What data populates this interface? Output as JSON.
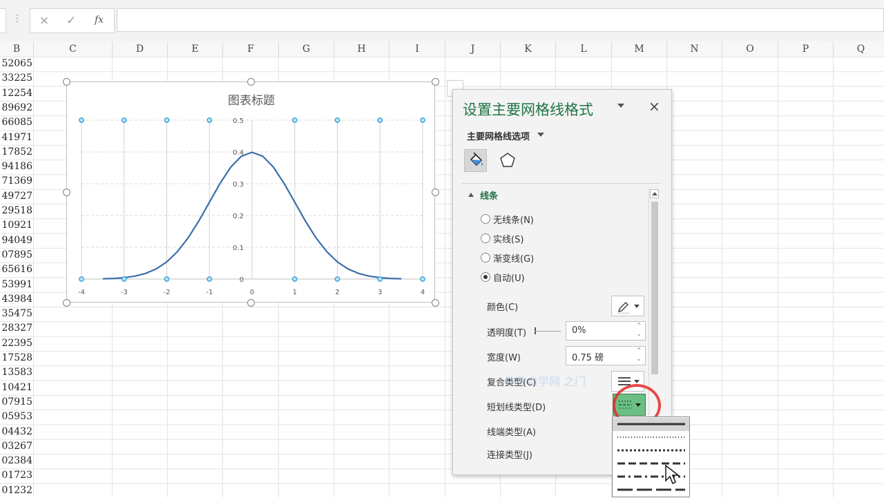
{
  "formula_bar": {
    "cancel_icon": "×",
    "enter_icon": "✓",
    "fx_label": "fx"
  },
  "columns": [
    "B",
    "C",
    "D",
    "E",
    "F",
    "G",
    "H",
    "I",
    "J",
    "K",
    "L",
    "M",
    "N",
    "O",
    "P",
    "Q"
  ],
  "column_b_values": [
    "52065",
    "33225",
    "12254",
    "89692",
    "66085",
    "41971",
    "17852",
    "94186",
    "71369",
    "49727",
    "29518",
    "10921",
    "94049",
    "07895",
    "65616",
    "53991",
    "43984",
    "35475",
    "28327",
    "22395",
    "17528",
    "13583",
    "10421",
    "07915",
    "05953",
    "04432",
    "03267",
    "02384",
    "01723",
    "01232"
  ],
  "chart": {
    "title": "图表标题"
  },
  "chart_data": {
    "type": "line",
    "title": "图表标题",
    "xlabel": "",
    "ylabel": "",
    "xlim": [
      -4,
      4
    ],
    "ylim": [
      0,
      0.5
    ],
    "x_ticks": [
      "-4",
      "-3",
      "-2",
      "-1",
      "0",
      "1",
      "2",
      "3",
      "4"
    ],
    "y_ticks": [
      "0",
      "0.1",
      "0.2",
      "0.3",
      "0.4",
      "0.5"
    ],
    "series": [
      {
        "values": [
          [
            -3.5,
            0.0009
          ],
          [
            -3.25,
            0.002
          ],
          [
            -3,
            0.0044
          ],
          [
            -2.75,
            0.0091
          ],
          [
            -2.5,
            0.0175
          ],
          [
            -2.25,
            0.0317
          ],
          [
            -2,
            0.054
          ],
          [
            -1.75,
            0.0863
          ],
          [
            -1.5,
            0.1295
          ],
          [
            -1.25,
            0.1826
          ],
          [
            -1,
            0.242
          ],
          [
            -0.75,
            0.3011
          ],
          [
            -0.5,
            0.3521
          ],
          [
            -0.25,
            0.3867
          ],
          [
            0,
            0.3989
          ],
          [
            0.25,
            0.3867
          ],
          [
            0.5,
            0.3521
          ],
          [
            0.75,
            0.3011
          ],
          [
            1,
            0.242
          ],
          [
            1.25,
            0.1826
          ],
          [
            1.5,
            0.1295
          ],
          [
            1.75,
            0.0863
          ],
          [
            2,
            0.054
          ],
          [
            2.25,
            0.0317
          ],
          [
            2.5,
            0.0175
          ],
          [
            2.75,
            0.0091
          ],
          [
            3,
            0.0044
          ],
          [
            3.25,
            0.002
          ],
          [
            3.5,
            0.0009
          ]
        ]
      }
    ],
    "grid": "dashed horizontal, selected vertical gridlines",
    "line_color": "#3b6ea8",
    "marker_color": "#2e9fd8"
  },
  "pane": {
    "title": "设置主要网格线格式",
    "close_icon": "×",
    "subtitle": "主要网格线选项",
    "section_title": "线条",
    "radio_options": [
      {
        "label": "无线条(N)",
        "checked": false
      },
      {
        "label": "实线(S)",
        "checked": false
      },
      {
        "label": "渐变线(G)",
        "checked": false
      },
      {
        "label": "自动(U)",
        "checked": true
      }
    ],
    "color_label": "颜色(C)",
    "transparency_label": "透明度(T)",
    "transparency_value": "0%",
    "width_label": "宽度(W)",
    "width_value": "0.75 磅",
    "compound_label": "复合类型(C)",
    "dash_label": "短划线类型(D)",
    "cap_label": "线端类型(A)",
    "join_label": "连接类型(J)",
    "watermark": "软件自学网 之门",
    "accent_color": "#217346",
    "dash_button_color": "#6cbf84"
  },
  "dash_options": [
    "solid",
    "round-dot",
    "square-dot",
    "dash",
    "dash-dot",
    "long-dash"
  ]
}
